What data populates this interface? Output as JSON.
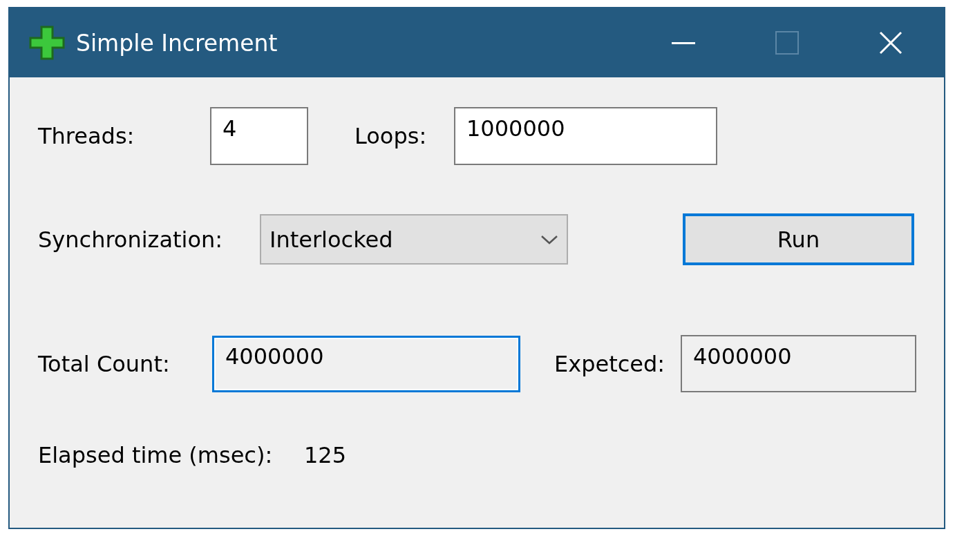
{
  "window": {
    "title": "Simple Increment"
  },
  "threads": {
    "label": "Threads:",
    "value": "4"
  },
  "loops": {
    "label": "Loops:",
    "value": "1000000"
  },
  "synchronization": {
    "label": "Synchronization:",
    "value": "Interlocked"
  },
  "run_button": {
    "label": "Run",
    "focused": true
  },
  "total_count": {
    "label": "Total Count:",
    "value": "4000000",
    "focused": true,
    "readonly": true
  },
  "expected": {
    "label": "Expetced:",
    "value": "4000000",
    "readonly": true
  },
  "elapsed": {
    "label": "Elapsed time (msec):",
    "value": "125"
  }
}
